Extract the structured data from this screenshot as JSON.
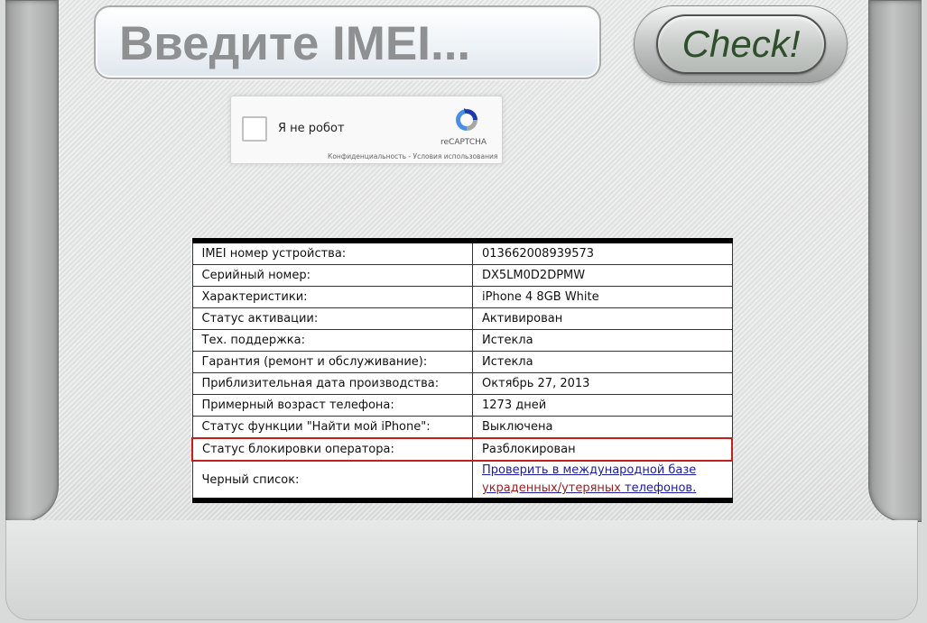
{
  "search": {
    "placeholder": "Введите IMEI...",
    "check_label": "Check!"
  },
  "captcha": {
    "label": "Я не робот",
    "brand": "reCAPTCHA",
    "privacy": "Конфиденциальность",
    "separator": " - ",
    "terms": "Условия использования"
  },
  "results": {
    "rows": [
      {
        "label": "IMEI номер устройства:",
        "value": "013662008939573"
      },
      {
        "label": "Серийный номер:",
        "value": "DX5LM0D2DPMW"
      },
      {
        "label": "Характеристики:",
        "value": "iPhone 4 8GB White"
      },
      {
        "label": "Статус активации:",
        "value": "Активирован"
      },
      {
        "label": "Тех. поддержка:",
        "value": "Истекла"
      },
      {
        "label": "Гарантия (ремонт и обслуживание):",
        "value": "Истекла"
      },
      {
        "label": "Приблизительная дата производства:",
        "value": "Октябрь 27, 2013"
      },
      {
        "label": "Примерный возраст телефона:",
        "value": "1273 дней"
      },
      {
        "label": "Статус функции \"Найти мой iPhone\":",
        "value": "Выключена"
      },
      {
        "label": "Статус блокировки оператора:",
        "value": "Разблокирован"
      }
    ],
    "blacklist": {
      "label": "Черный список:",
      "link_part1": "Проверить в международной базе",
      "link_part2": "украденных/утеряных",
      "link_part3": " телефонов."
    }
  },
  "colors": {
    "highlight_border": "#c21f1f",
    "link": "#1a1aa6",
    "link_red": "#9b1f1f"
  }
}
